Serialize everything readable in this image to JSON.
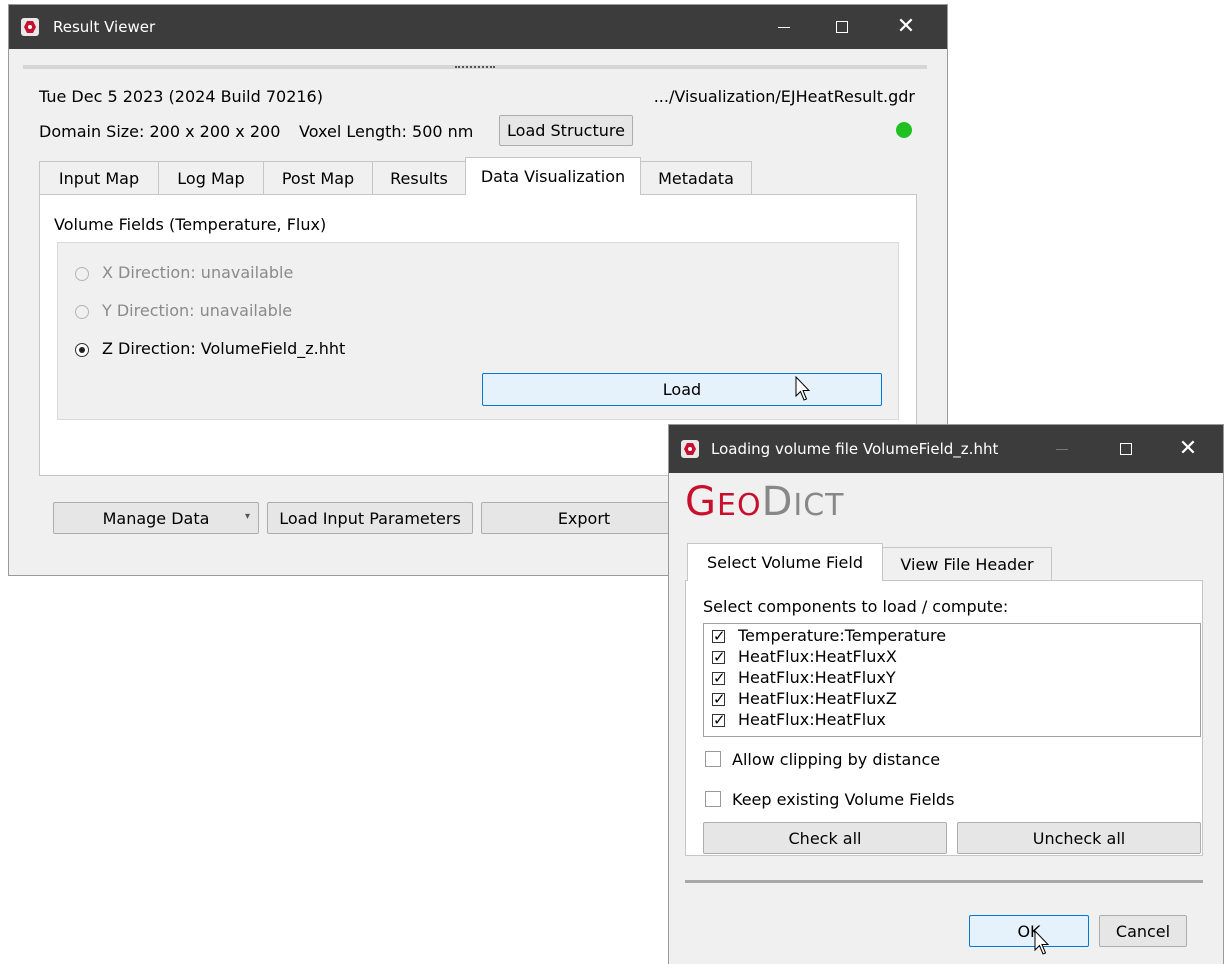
{
  "result_viewer": {
    "title": "Result Viewer",
    "date_build": "Tue Dec 5 2023 (2024 Build 70216)",
    "file_path": ".../Visualization/EJHeatResult.gdr",
    "domain_size": "Domain Size: 200 x 200 x 200",
    "voxel_length": "Voxel Length: 500 nm",
    "load_structure_label": "Load Structure",
    "status_color": "#1fc01f",
    "tabs": [
      {
        "label": "Input Map"
      },
      {
        "label": "Log Map"
      },
      {
        "label": "Post Map"
      },
      {
        "label": "Results"
      },
      {
        "label": "Data Visualization",
        "active": true
      },
      {
        "label": "Metadata"
      }
    ],
    "group_title": "Volume Fields (Temperature, Flux)",
    "radios": [
      {
        "label": "X Direction:  unavailable",
        "enabled": false,
        "checked": false
      },
      {
        "label": "Y Direction:  unavailable",
        "enabled": false,
        "checked": false
      },
      {
        "label": "Z Direction: VolumeField_z.hht",
        "enabled": true,
        "checked": true
      }
    ],
    "load_label": "Load",
    "footer_buttons": {
      "manage_data": "Manage Data",
      "load_input_parameters": "Load Input Parameters",
      "export": "Export"
    }
  },
  "loading_dialog": {
    "title": "Loading volume file VolumeField_z.hht",
    "logo_text": "GeoDict",
    "tabs": [
      {
        "label": "Select Volume Field",
        "active": true
      },
      {
        "label": "View File Header"
      }
    ],
    "instruction": "Select components to load / compute:",
    "components": [
      {
        "label": "Temperature:Temperature",
        "checked": true
      },
      {
        "label": "HeatFlux:HeatFluxX",
        "checked": true
      },
      {
        "label": "HeatFlux:HeatFluxY",
        "checked": true
      },
      {
        "label": "HeatFlux:HeatFluxZ",
        "checked": true
      },
      {
        "label": "HeatFlux:HeatFlux",
        "checked": true
      }
    ],
    "options": [
      {
        "label": "Allow clipping by distance",
        "checked": false
      },
      {
        "label": "Keep existing Volume Fields",
        "checked": false
      }
    ],
    "check_all_label": "Check all",
    "uncheck_all_label": "Uncheck all",
    "ok_label": "OK",
    "cancel_label": "Cancel"
  }
}
